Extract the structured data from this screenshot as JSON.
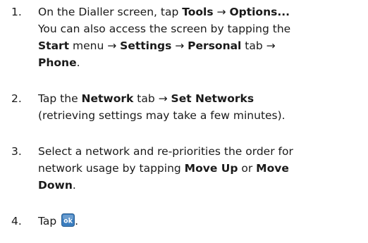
{
  "steps": [
    {
      "number": "1.",
      "lines": [
        [
          {
            "t": "On the Dialler screen, tap ",
            "b": false
          },
          {
            "t": "Tools",
            "b": true
          },
          {
            "t": " → ",
            "b": false
          },
          {
            "t": "Options...",
            "b": true
          }
        ],
        [
          {
            "t": "You can also access the screen by tapping the",
            "b": false
          }
        ],
        [
          {
            "t": "Start",
            "b": true
          },
          {
            "t": " menu → ",
            "b": false
          },
          {
            "t": "Settings",
            "b": true
          },
          {
            "t": " → ",
            "b": false
          },
          {
            "t": "Personal",
            "b": true
          },
          {
            "t": " tab →",
            "b": false
          }
        ],
        [
          {
            "t": "Phone",
            "b": true
          },
          {
            "t": ".",
            "b": false
          }
        ]
      ]
    },
    {
      "number": "2.",
      "lines": [
        [
          {
            "t": "Tap the ",
            "b": false
          },
          {
            "t": "Network",
            "b": true
          },
          {
            "t": " tab → ",
            "b": false
          },
          {
            "t": "Set Networks",
            "b": true
          }
        ],
        [
          {
            "t": "(retrieving settings may take a few minutes).",
            "b": false
          }
        ]
      ]
    },
    {
      "number": "3.",
      "lines": [
        [
          {
            "t": "Select a network and re-priorities the order for",
            "b": false
          }
        ],
        [
          {
            "t": "network usage by tapping ",
            "b": false
          },
          {
            "t": "Move Up",
            "b": true
          },
          {
            "t": " or ",
            "b": false
          },
          {
            "t": "Move",
            "b": true
          }
        ],
        [
          {
            "t": "Down",
            "b": true
          },
          {
            "t": ".",
            "b": false
          }
        ]
      ]
    },
    {
      "number": "4.",
      "lines": [
        [
          {
            "t": "Tap ",
            "b": false
          },
          {
            "icon": "ok-icon",
            "label": "ok"
          },
          {
            "t": ".",
            "b": false
          }
        ]
      ]
    }
  ],
  "colors": {
    "text": "#1a1a1a",
    "ok_icon_bg": "#3a7dbf",
    "ok_icon_text": "#ffffff"
  }
}
